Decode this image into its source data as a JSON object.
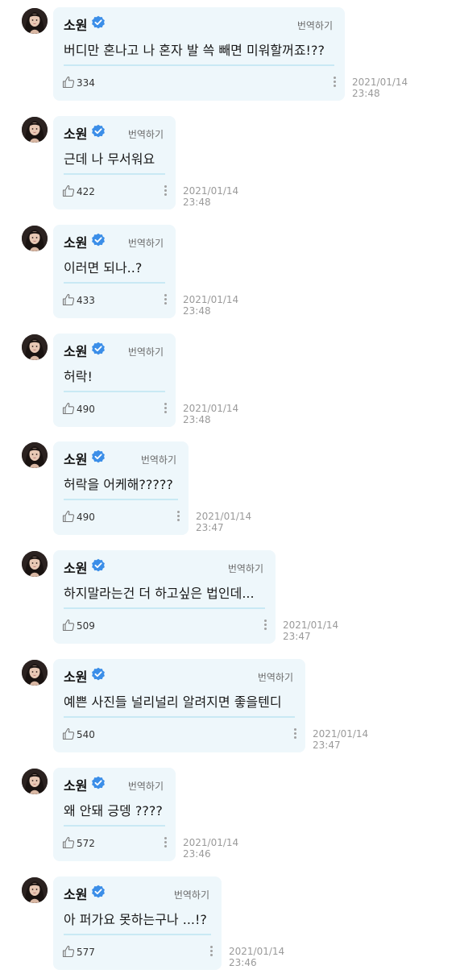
{
  "messages": [
    {
      "name": "소원",
      "translate": "번역하기",
      "text": "버디만 혼나고 나 혼자 발 쓱 빼면 미워할꺼죠!??",
      "likes": "334",
      "date": "2021/01/14",
      "time": "23:48"
    },
    {
      "name": "소원",
      "translate": "번역하기",
      "text": "근데 나 무서워요",
      "likes": "422",
      "date": "2021/01/14",
      "time": "23:48"
    },
    {
      "name": "소원",
      "translate": "번역하기",
      "text": "이러면 되나..?",
      "likes": "433",
      "date": "2021/01/14",
      "time": "23:48"
    },
    {
      "name": "소원",
      "translate": "번역하기",
      "text": "허락!",
      "likes": "490",
      "date": "2021/01/14",
      "time": "23:48"
    },
    {
      "name": "소원",
      "translate": "번역하기",
      "text": "허락을 어케해?????",
      "likes": "490",
      "date": "2021/01/14",
      "time": "23:47"
    },
    {
      "name": "소원",
      "translate": "번역하기",
      "text": "하지말라는건 더 하고싶은 법인데...",
      "likes": "509",
      "date": "2021/01/14",
      "time": "23:47"
    },
    {
      "name": "소원",
      "translate": "번역하기",
      "text": "예쁜 사진들 널리널리 알려지면 좋을텐디",
      "likes": "540",
      "date": "2021/01/14",
      "time": "23:47"
    },
    {
      "name": "소원",
      "translate": "번역하기",
      "text": "왜 안돼 긍뎅 ????",
      "likes": "572",
      "date": "2021/01/14",
      "time": "23:46"
    },
    {
      "name": "소원",
      "translate": "번역하기",
      "text": "아 퍼가요 못하는구나 ...!?",
      "likes": "577",
      "date": "2021/01/14",
      "time": "23:46"
    }
  ],
  "icons": {
    "verified": "verified-check-icon",
    "like": "thumbs-up-icon",
    "more": "more-vertical-icon"
  },
  "colors": {
    "bubble": "#eef7fb",
    "divider": "#c9e9f4",
    "verified": "#3b8ee8"
  }
}
